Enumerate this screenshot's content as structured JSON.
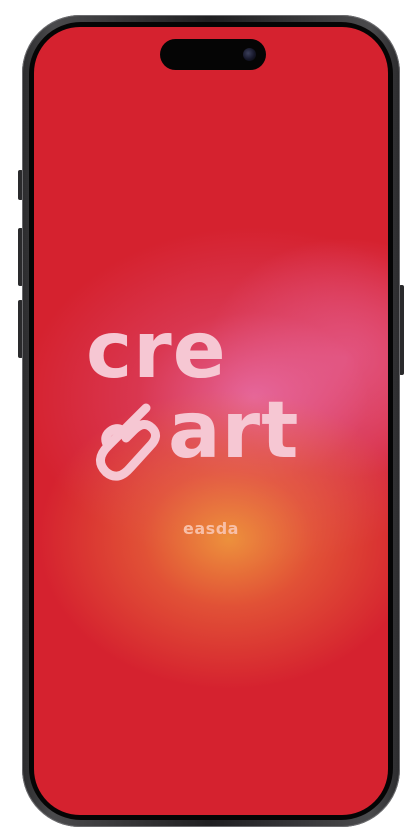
{
  "splash": {
    "logo_text_top": "cre",
    "logo_text_bottom": "art",
    "tagline": "easda",
    "heart_icon": "heart-outline-icon"
  },
  "colors": {
    "background": "#d5222f",
    "glow_pink": "#e870aa",
    "glow_orange": "#ee963c",
    "logo_text": "#f6c7d3",
    "tagline_text": "#f8bfa7"
  }
}
